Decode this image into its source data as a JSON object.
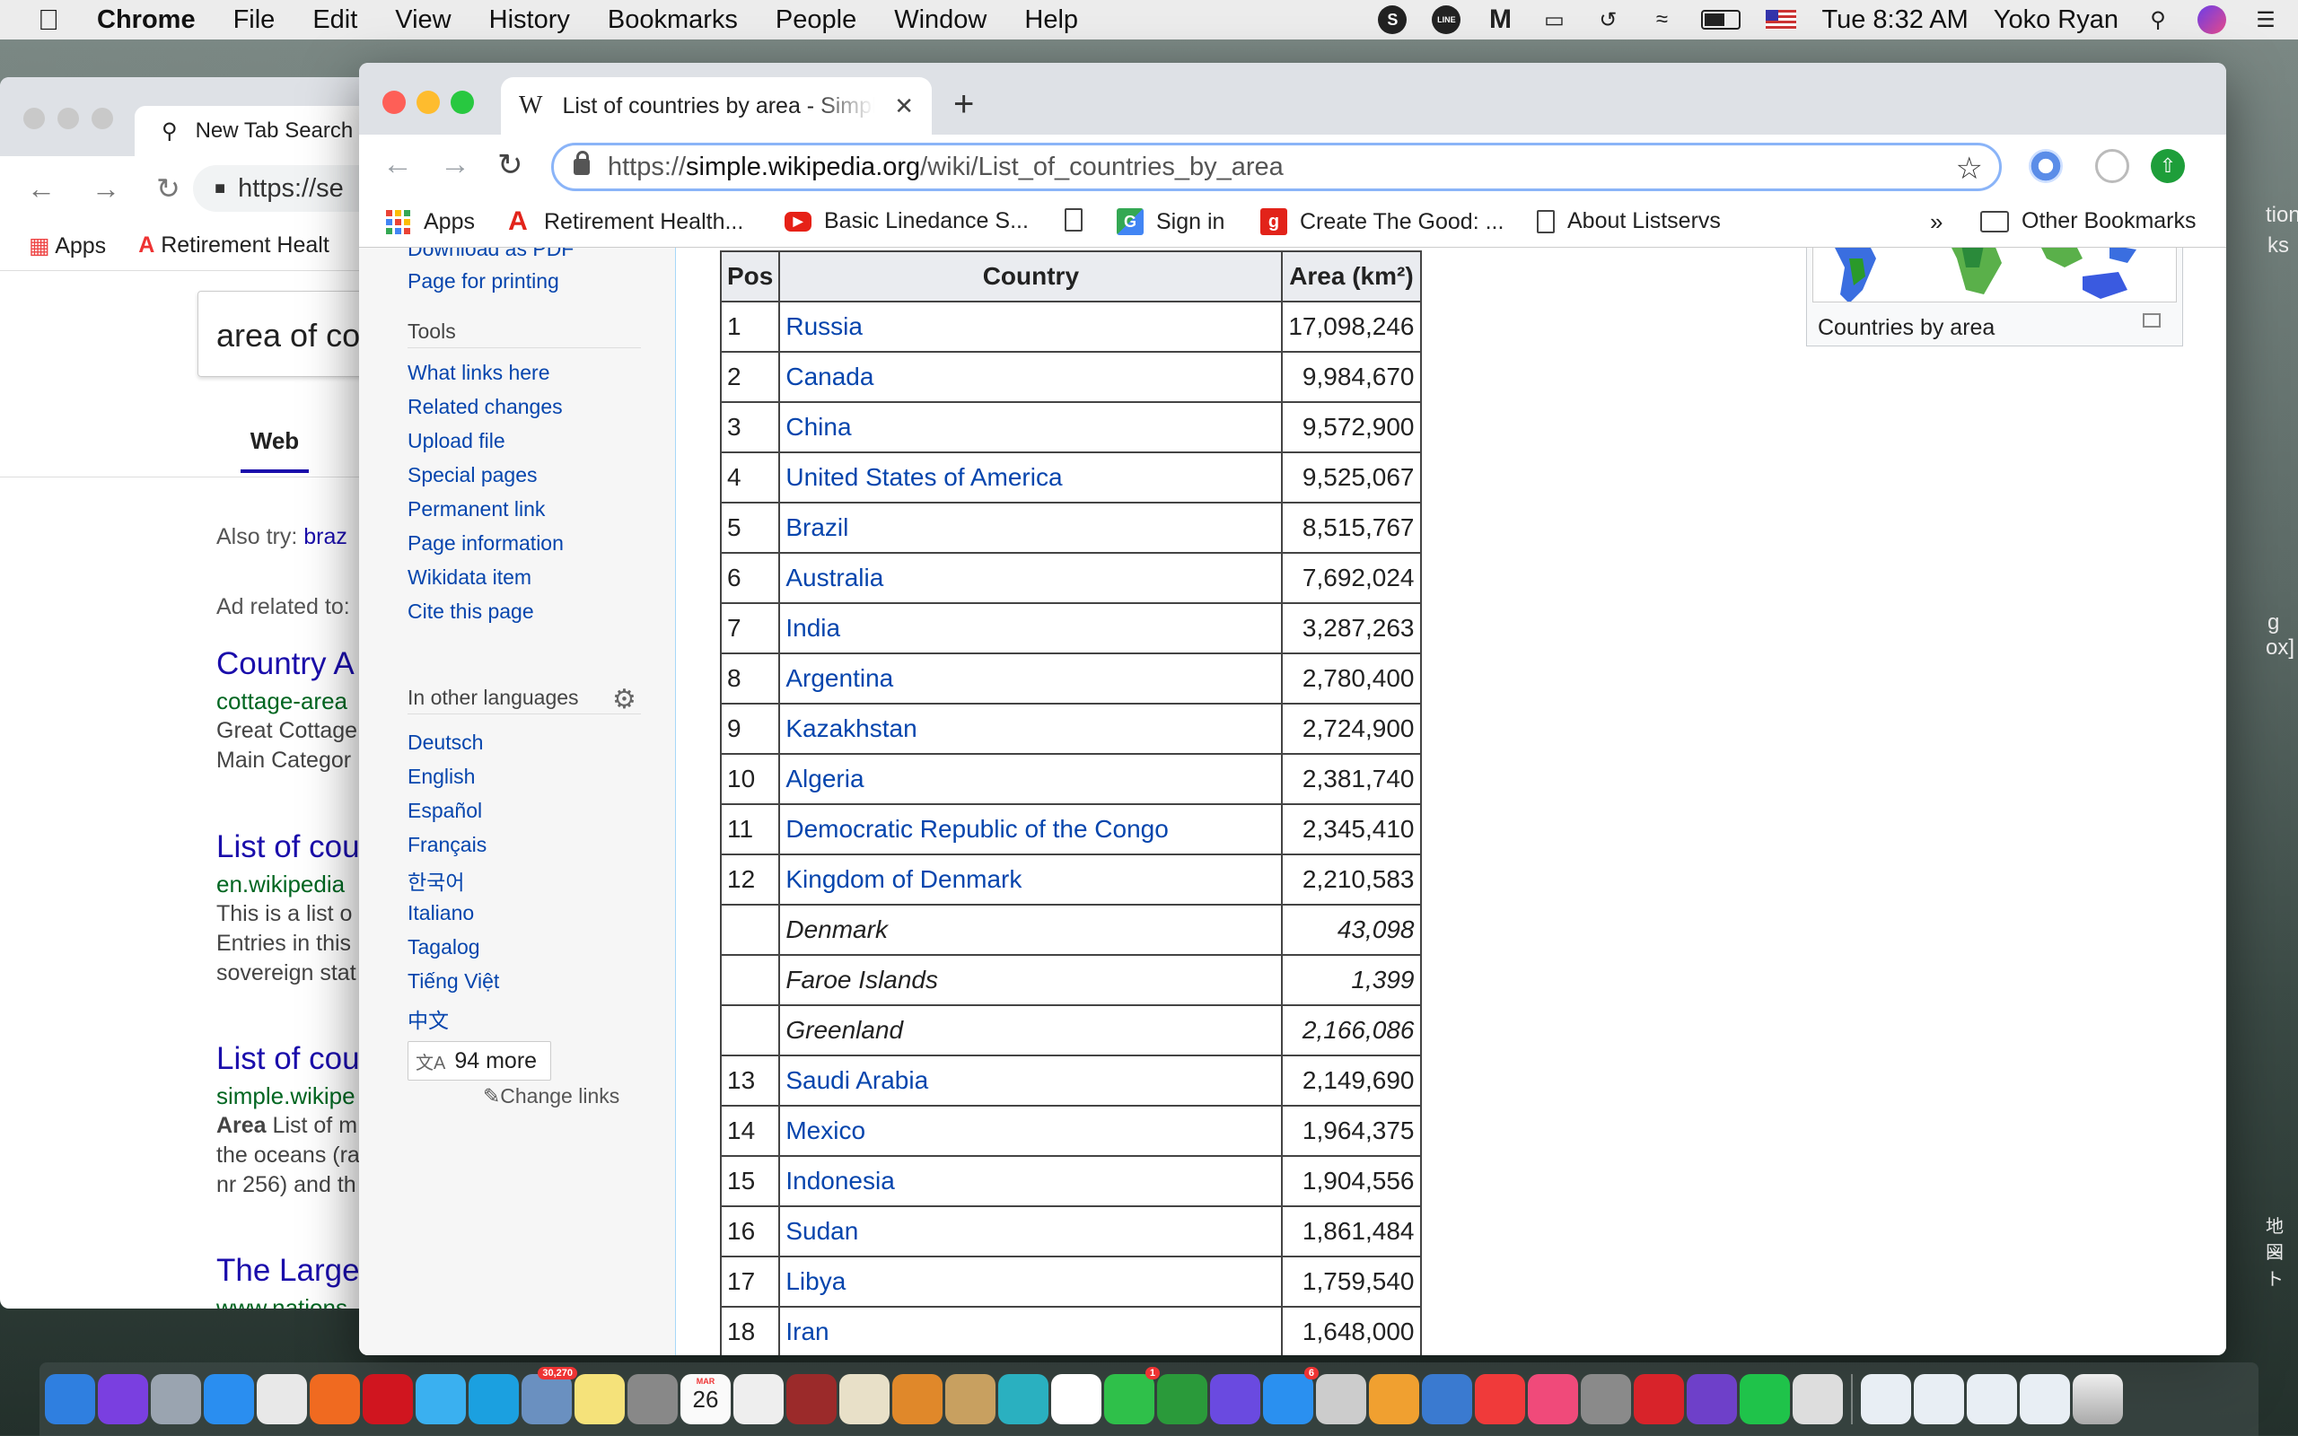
{
  "menubar": {
    "app_name": "Chrome",
    "menus": [
      "File",
      "Edit",
      "View",
      "History",
      "Bookmarks",
      "People",
      "Window",
      "Help"
    ],
    "clock": "Tue 8:32 AM",
    "user": "Yoko Ryan",
    "line_icon_text": "LINE"
  },
  "bg_window": {
    "tab_title": "New Tab Search",
    "url": "https://se",
    "bookmarks": [
      "Apps",
      "Retirement Healt"
    ],
    "search_text": "area of co",
    "web_tab": "Web",
    "also_try": "Also try:",
    "also_try_link": "braz",
    "ad_related": "Ad related to:",
    "results": [
      {
        "title": "Country A",
        "url": "cottage-area",
        "desc": [
          "Great Cottage",
          "Main Categor"
        ]
      },
      {
        "title": "List of cou",
        "url": "en.wikipedia",
        "desc": [
          "This is a list o",
          "Entries in this",
          "sovereign stat"
        ]
      },
      {
        "title": "List of cou",
        "url": "simple.wikipe",
        "desc_bold": "Area",
        "desc": [
          "List of m",
          "the oceans (ra",
          "nr 256) and th"
        ]
      },
      {
        "title": "The Large",
        "url": "www.nations"
      }
    ],
    "edge_fragments": [
      "tion",
      "ks",
      "g",
      "ox]",
      "地図",
      "ート"
    ]
  },
  "fg_window": {
    "tab_title": "List of countries by area - Simple English Wikipedia",
    "url_proto": "https://",
    "url_host": "simple.wikipedia.org",
    "url_path": "/wiki/List_of_countries_by_area",
    "bookmarks": [
      {
        "label": "Apps",
        "icon": "apps-grid-icon"
      },
      {
        "label": "Retirement Health...",
        "icon": "aarp-icon"
      },
      {
        "label": "Basic Linedance S...",
        "icon": "youtube-icon"
      },
      {
        "label": "",
        "icon": "document-icon"
      },
      {
        "label": "Sign in",
        "icon": "google-maps-icon"
      },
      {
        "label": "Create The Good: ...",
        "icon": "g-icon"
      },
      {
        "label": "About Listservs",
        "icon": "document-icon"
      }
    ],
    "more_bookmarks": "»",
    "other_bookmarks": "Other Bookmarks"
  },
  "wiki_sidebar": {
    "top_links": [
      "Download as PDF",
      "Page for printing"
    ],
    "tools_heading": "Tools",
    "tools": [
      "What links here",
      "Related changes",
      "Upload file",
      "Special pages",
      "Permanent link",
      "Page information",
      "Wikidata item",
      "Cite this page"
    ],
    "languages_heading": "In other languages",
    "languages": [
      "Deutsch",
      "English",
      "Español",
      "Français",
      "한국어",
      "Italiano",
      "Tagalog",
      "Tiếng Việt",
      "中文"
    ],
    "more_button": "94 more",
    "change_links": "Change links"
  },
  "table": {
    "headers": [
      "Pos",
      "Country",
      "Area (km²)"
    ],
    "rows": [
      {
        "pos": "1",
        "country": "Russia",
        "area": "17,098,246",
        "link": true
      },
      {
        "pos": "2",
        "country": "Canada",
        "area": "9,984,670",
        "link": true
      },
      {
        "pos": "3",
        "country": "China",
        "area": "9,572,900",
        "link": true
      },
      {
        "pos": "4",
        "country": "United States of America",
        "area": "9,525,067",
        "link": true
      },
      {
        "pos": "5",
        "country": "Brazil",
        "area": "8,515,767",
        "link": true
      },
      {
        "pos": "6",
        "country": "Australia",
        "area": "7,692,024",
        "link": true
      },
      {
        "pos": "7",
        "country": "India",
        "area": "3,287,263",
        "link": true
      },
      {
        "pos": "8",
        "country": "Argentina",
        "area": "2,780,400",
        "link": true
      },
      {
        "pos": "9",
        "country": "Kazakhstan",
        "area": "2,724,900",
        "link": true
      },
      {
        "pos": "10",
        "country": "Algeria",
        "area": "2,381,740",
        "link": true
      },
      {
        "pos": "11",
        "country": "Democratic Republic of the Congo",
        "area": "2,345,410",
        "link": true
      },
      {
        "pos": "12",
        "country": "Kingdom of Denmark",
        "area": "2,210,583",
        "link": true
      },
      {
        "pos": "",
        "country": "Denmark",
        "area": "43,098",
        "link": false
      },
      {
        "pos": "",
        "country": "Faroe Islands",
        "area": "1,399",
        "link": false
      },
      {
        "pos": "",
        "country": "Greenland",
        "area": "2,166,086",
        "link": false
      },
      {
        "pos": "13",
        "country": "Saudi Arabia",
        "area": "2,149,690",
        "link": true
      },
      {
        "pos": "14",
        "country": "Mexico",
        "area": "1,964,375",
        "link": true
      },
      {
        "pos": "15",
        "country": "Indonesia",
        "area": "1,904,556",
        "link": true
      },
      {
        "pos": "16",
        "country": "Sudan",
        "area": "1,861,484",
        "link": true
      },
      {
        "pos": "17",
        "country": "Libya",
        "area": "1,759,540",
        "link": true
      },
      {
        "pos": "18",
        "country": "Iran",
        "area": "1,648,000",
        "link": true
      }
    ]
  },
  "thumb": {
    "caption": "Countries by area"
  },
  "dock": {
    "badges": {
      "calendar_day": "26",
      "calendar_month": "MAR",
      "mail": "30,270",
      "facetime": "1",
      "appstore": "6"
    },
    "apps": [
      "finder",
      "siri",
      "launchpad",
      "safari",
      "chrome",
      "firefox",
      "opera",
      "messages",
      "skype",
      "mail",
      "notes",
      "calculator",
      "calendar",
      "textedit",
      "dictionary",
      "preview",
      "sublime",
      "books",
      "notability",
      "photos",
      "facetime",
      "numbers",
      "imovie",
      "appstore",
      "printer",
      "pages",
      "keynote",
      "news",
      "music",
      "system-preferences",
      "pdf",
      "github",
      "line",
      "sequel"
    ],
    "colors": {
      "finder": "#2f7fe0",
      "siri": "#7a3fe0",
      "launchpad": "#9aa4b0",
      "safari": "#2a8ef0",
      "chrome": "#e8e8e8",
      "firefox": "#f06a20",
      "opera": "#d0151f",
      "messages": "#3ab0f0",
      "skype": "#1ba0e0",
      "mail": "#6a90c0",
      "notes": "#f5e27a",
      "calculator": "#888888",
      "calendar": "#fafafa",
      "textedit": "#eeeeee",
      "dictionary": "#9b2a2a",
      "preview": "#e8e0c8",
      "sublime": "#e0882a",
      "books": "#c8a060",
      "notability": "#2ab0c0",
      "photos": "#ffffff",
      "facetime": "#2fc04a",
      "numbers": "#2a9a3a",
      "imovie": "#6a4ae0",
      "appstore": "#2a90f0",
      "printer": "#cccccc",
      "pages": "#f0a030",
      "keynote": "#3a7ad0",
      "news": "#f03a3a",
      "music": "#f04a7a",
      "system-preferences": "#8a8a8a",
      "pdf": "#d8232a",
      "github": "#6e40c9",
      "line": "#1fc34a",
      "sequel": "#dddddd"
    }
  }
}
